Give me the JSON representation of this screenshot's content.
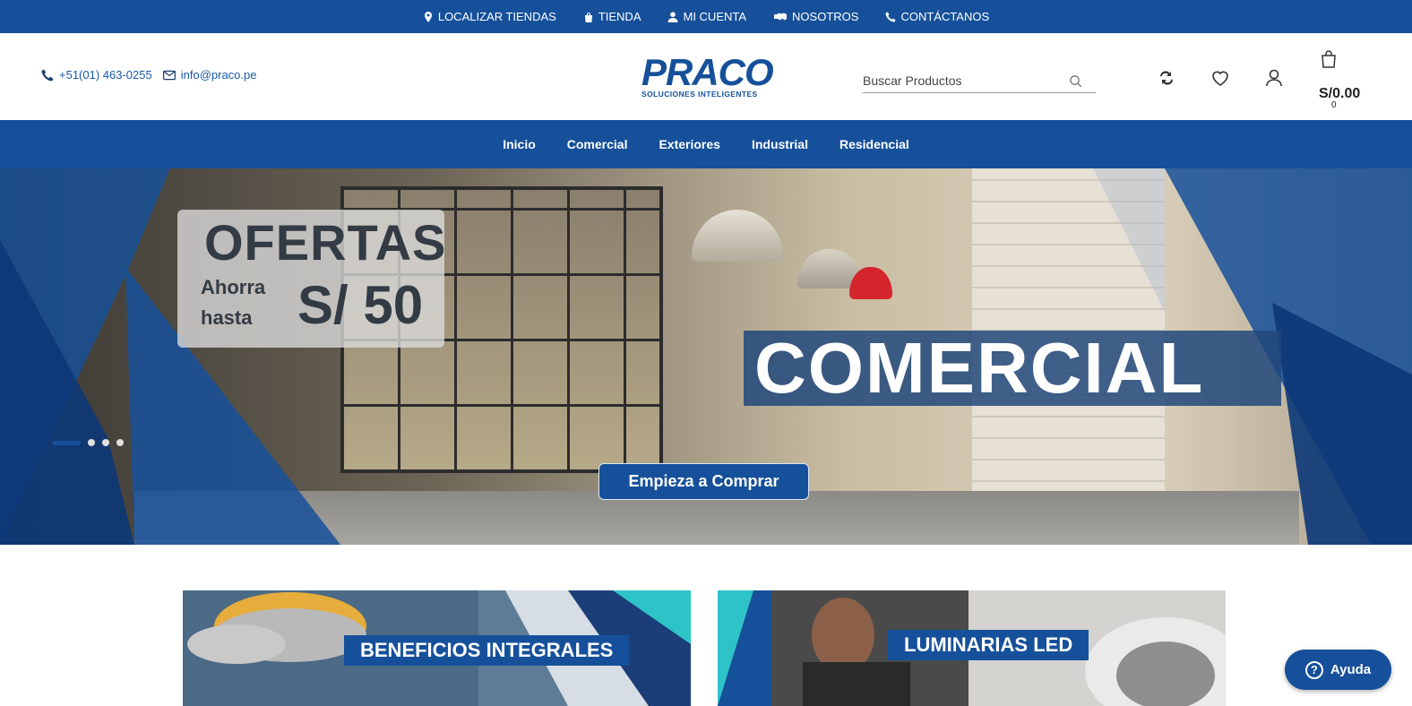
{
  "topbar": {
    "links": [
      {
        "label": "LOCALIZAR TIENDAS",
        "icon": "map-pin-icon"
      },
      {
        "label": "TIENDA",
        "icon": "shopping-bag-icon"
      },
      {
        "label": "MI CUENTA",
        "icon": "user-icon"
      },
      {
        "label": "NOSOTROS",
        "icon": "handshake-icon"
      },
      {
        "label": "CONTÁCTANOS",
        "icon": "phone-icon"
      }
    ]
  },
  "header": {
    "phone": "+51(01) 463-0255",
    "email": "info@praco.pe",
    "logo_word": "PRACO",
    "logo_tagline": "SOLUCIONES INTELIGENTES",
    "search_placeholder": "Buscar Productos",
    "cart_total": "S/0.00",
    "cart_count": "0"
  },
  "nav": {
    "items": [
      "Inicio",
      "Comercial",
      "Exteriores",
      "Industrial",
      "Residencial"
    ]
  },
  "hero": {
    "offer_title": "OFERTAS",
    "offer_sub": "Ahorra hasta",
    "offer_amount": "S/ 50",
    "headline": "COMERCIAL",
    "cta": "Empieza a Comprar",
    "slides_total": 4,
    "active_slide": 1
  },
  "banners": [
    {
      "label": "BENEFICIOS INTEGRALES"
    },
    {
      "label": "LUMINARIAS LED"
    }
  ],
  "help": {
    "label": "Ayuda"
  },
  "colors": {
    "brand": "#16509a",
    "white": "#ffffff"
  }
}
